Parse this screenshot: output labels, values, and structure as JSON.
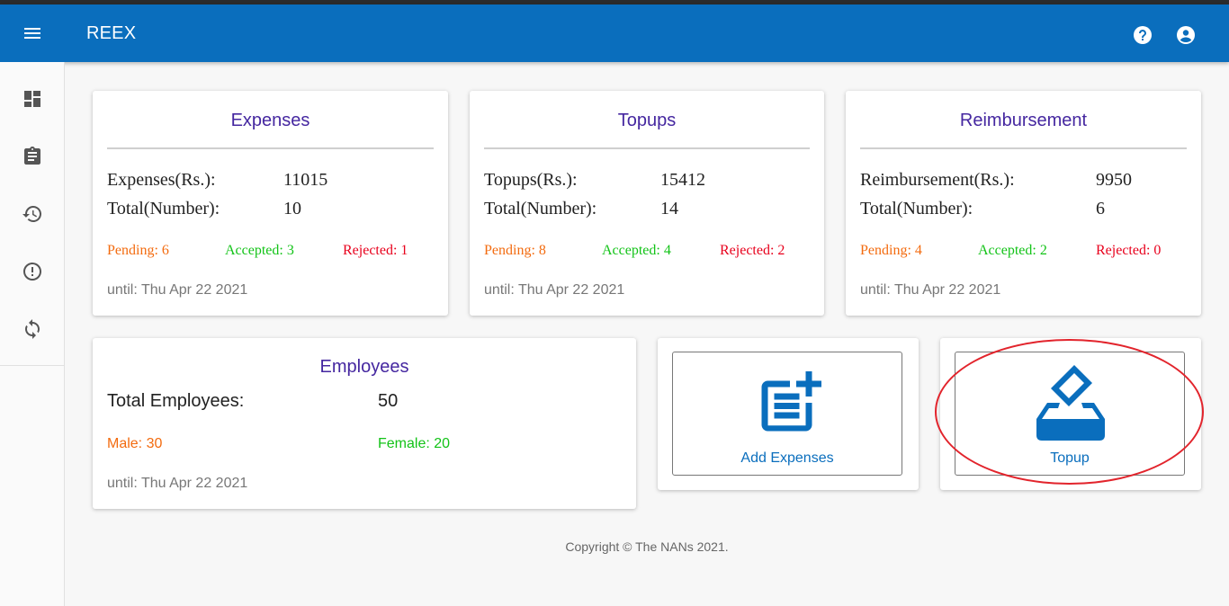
{
  "app": {
    "title": "REEX"
  },
  "header": {
    "menu_icon": "menu-icon",
    "help_icon": "help-icon",
    "account_icon": "account-circle-icon"
  },
  "sidebar": {
    "items": [
      {
        "icon": "dashboard-icon"
      },
      {
        "icon": "clipboard-icon"
      },
      {
        "icon": "history-icon"
      },
      {
        "icon": "alert-circle-icon"
      },
      {
        "icon": "sync-icon"
      }
    ]
  },
  "cards": {
    "expenses": {
      "title": "Expenses",
      "amount_label": "Expenses(Rs.):",
      "amount_value": "11015",
      "total_label": "Total(Number):",
      "total_value": "10",
      "pending": "Pending: 6",
      "accepted": "Accepted: 3",
      "rejected": "Rejected: 1",
      "until": "until: Thu Apr 22 2021"
    },
    "topups": {
      "title": "Topups",
      "amount_label": "Topups(Rs.):",
      "amount_value": "15412",
      "total_label": "Total(Number):",
      "total_value": "14",
      "pending": "Pending: 8",
      "accepted": "Accepted: 4",
      "rejected": "Rejected: 2",
      "until": "until: Thu Apr 22 2021"
    },
    "reimbursement": {
      "title": "Reimbursement",
      "amount_label": "Reimbursement(Rs.):",
      "amount_value": "9950",
      "total_label": "Total(Number):",
      "total_value": "6",
      "pending": "Pending: 4",
      "accepted": "Accepted: 2",
      "rejected": "Rejected: 0",
      "until": "until: Thu Apr 22 2021"
    },
    "employees": {
      "title": "Employees",
      "total_label": "Total Employees:",
      "total_value": "50",
      "male": "Male: 30",
      "female": "Female: 20",
      "until": "until: Thu Apr 22 2021"
    }
  },
  "actions": {
    "add_expenses": {
      "label": "Add Expenses",
      "icon": "post-add-icon"
    },
    "topup": {
      "label": "Topup",
      "icon": "ballot-box-icon"
    }
  },
  "footer": {
    "copyright": "Copyright © The NANs 2021."
  },
  "colors": {
    "primary": "#0a6ebd",
    "title": "#4527a0",
    "pending": "#f36b0f",
    "accepted": "#12c317",
    "rejected": "#e8001c",
    "annotation": "#e2242c"
  }
}
